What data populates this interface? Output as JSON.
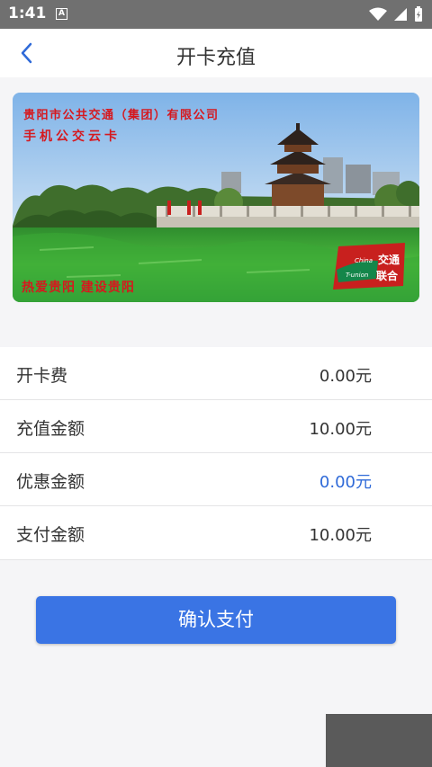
{
  "status_bar": {
    "time": "1:41",
    "notification_badge": "A"
  },
  "nav": {
    "title": "开卡充值",
    "back_icon": "chevron-left-icon"
  },
  "card": {
    "company": "贵阳市公共交通（集团）有限公司",
    "card_name": "手机公交云卡",
    "slogan": "热爱贵阳  建设贵阳",
    "logo": {
      "cn_top": "交通",
      "cn_bottom": "联合",
      "en_top": "China",
      "en_bottom": "T-union"
    }
  },
  "fees": [
    {
      "label": "开卡费",
      "value": "0.00元",
      "highlight": false
    },
    {
      "label": "充值金额",
      "value": "10.00元",
      "highlight": false
    },
    {
      "label": "优惠金额",
      "value": "0.00元",
      "highlight": true
    },
    {
      "label": "支付金额",
      "value": "10.00元",
      "highlight": false
    }
  ],
  "pay_button": {
    "label": "确认支付"
  },
  "colors": {
    "accent": "#3a74e4",
    "highlight_value": "#2f6ad8",
    "card_text": "#d6181e"
  }
}
